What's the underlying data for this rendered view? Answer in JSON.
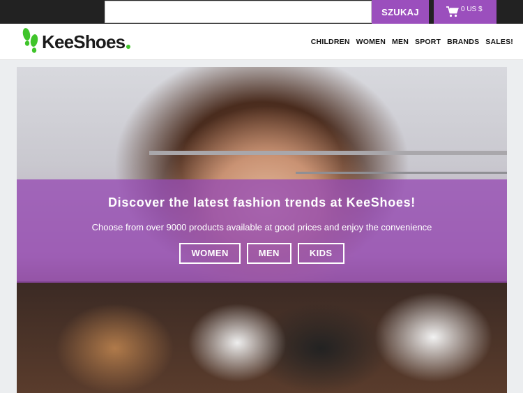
{
  "search": {
    "placeholder": "",
    "value": "",
    "button_label": "SZUKAJ"
  },
  "cart": {
    "icon": "cart-icon",
    "label": "0 US $"
  },
  "brand": {
    "logo_text": "KeeShoes",
    "logo_icon": "footprints-icon",
    "accent_green": "#3fc42a",
    "accent_purple": "#9b4fbd"
  },
  "nav": {
    "items": [
      {
        "label": "CHILDREN"
      },
      {
        "label": "WOMEN"
      },
      {
        "label": "MEN"
      },
      {
        "label": "SPORT"
      },
      {
        "label": "BRANDS"
      },
      {
        "label": "SALES!"
      }
    ]
  },
  "hero": {
    "title": "Discover the latest fashion trends at KeeShoes!",
    "subtitle": "Choose from over 9000 products available at good prices and enjoy the convenience",
    "buttons": [
      {
        "label": "WOMEN"
      },
      {
        "label": "MEN"
      },
      {
        "label": "KIDS"
      }
    ]
  }
}
